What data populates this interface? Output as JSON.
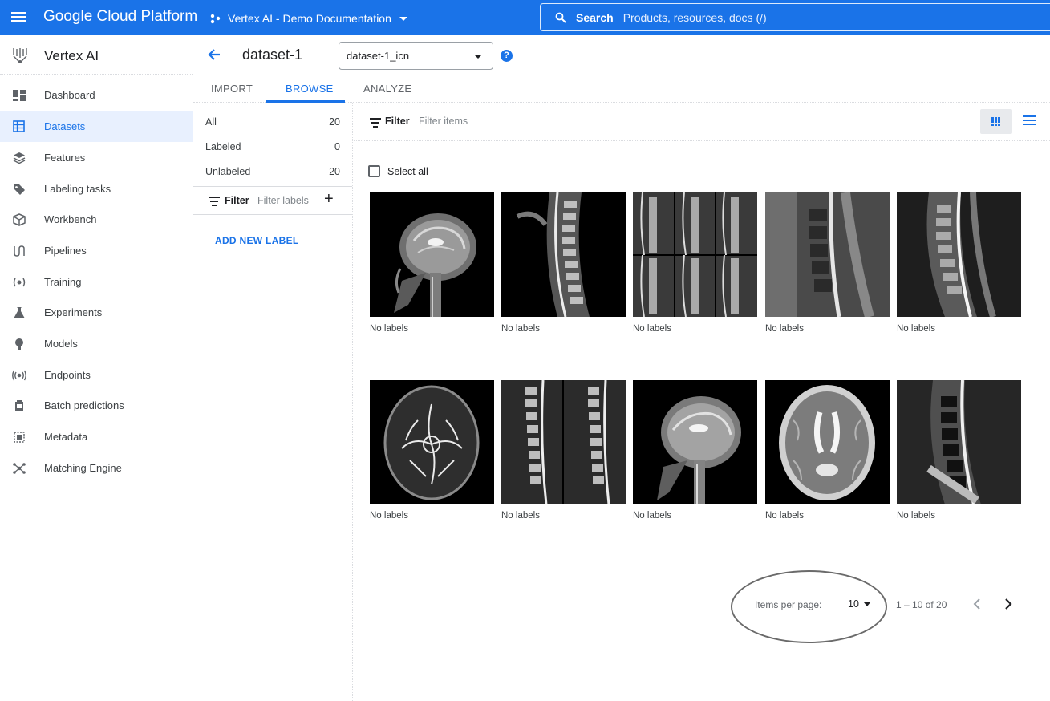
{
  "topbar": {
    "brand": "Google Cloud Platform",
    "project": "Vertex AI - Demo Documentation",
    "search_label": "Search",
    "search_placeholder": "Products, resources, docs (/)"
  },
  "nav": {
    "title": "Vertex AI",
    "items": [
      {
        "label": "Dashboard",
        "icon": "dashboard-icon"
      },
      {
        "label": "Datasets",
        "icon": "datasets-icon",
        "active": true
      },
      {
        "label": "Features",
        "icon": "features-icon"
      },
      {
        "label": "Labeling tasks",
        "icon": "label-icon"
      },
      {
        "label": "Workbench",
        "icon": "workbench-icon"
      },
      {
        "label": "Pipelines",
        "icon": "pipelines-icon"
      },
      {
        "label": "Training",
        "icon": "training-icon"
      },
      {
        "label": "Experiments",
        "icon": "flask-icon"
      },
      {
        "label": "Models",
        "icon": "lightbulb-icon"
      },
      {
        "label": "Endpoints",
        "icon": "broadcast-icon"
      },
      {
        "label": "Batch predictions",
        "icon": "batch-icon"
      },
      {
        "label": "Metadata",
        "icon": "metadata-icon"
      },
      {
        "label": "Matching Engine",
        "icon": "network-icon"
      }
    ]
  },
  "header": {
    "title": "dataset-1",
    "annotation_set": "dataset-1_icn"
  },
  "tabs": [
    {
      "label": "IMPORT"
    },
    {
      "label": "BROWSE",
      "active": true
    },
    {
      "label": "ANALYZE"
    }
  ],
  "label_panel": {
    "counts": [
      {
        "label": "All",
        "value": "20"
      },
      {
        "label": "Labeled",
        "value": "0"
      },
      {
        "label": "Unlabeled",
        "value": "20"
      }
    ],
    "filter_label": "Filter",
    "filter_placeholder": "Filter labels",
    "add_symbol": "+",
    "add_new_label": "ADD NEW LABEL"
  },
  "content": {
    "filter_label": "Filter",
    "filter_placeholder": "Filter items",
    "select_all": "Select all",
    "items": [
      {
        "caption": "No labels",
        "kind": "sagittal-brain"
      },
      {
        "caption": "No labels",
        "kind": "spine"
      },
      {
        "caption": "No labels",
        "kind": "spine-grid"
      },
      {
        "caption": "No labels",
        "kind": "lumbar"
      },
      {
        "caption": "No labels",
        "kind": "spine"
      },
      {
        "caption": "No labels",
        "kind": "axial-vessels"
      },
      {
        "caption": "No labels",
        "kind": "spine-pair"
      },
      {
        "caption": "No labels",
        "kind": "sagittal-brain"
      },
      {
        "caption": "No labels",
        "kind": "axial-brain"
      },
      {
        "caption": "No labels",
        "kind": "lumbar"
      }
    ]
  },
  "pagination": {
    "items_per_page_label": "Items per page:",
    "items_per_page": "10",
    "range": "1 – 10 of 20"
  },
  "colors": {
    "brand_blue": "#1a73e8",
    "active_bg": "#e8f0fe"
  }
}
